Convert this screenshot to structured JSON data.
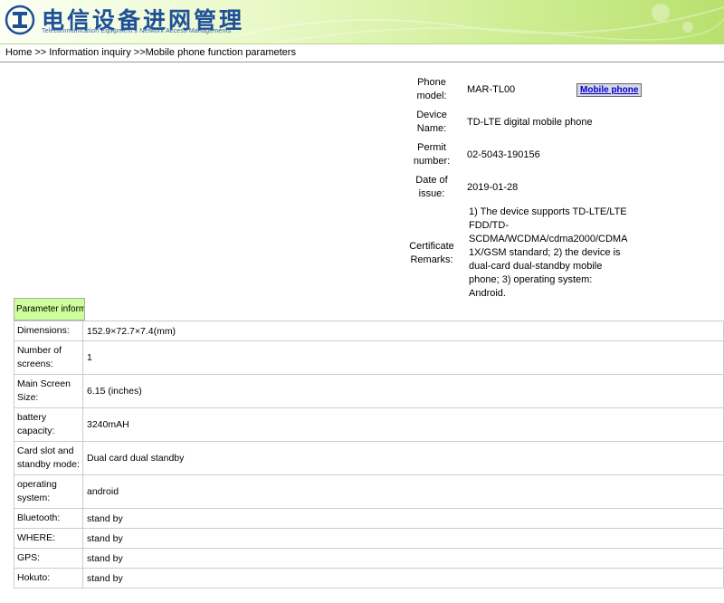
{
  "header": {
    "title_cn": "电信设备进网管理",
    "title_en": "Telecommunication Equipment's Network Access Managements"
  },
  "breadcrumb": {
    "home": "Home",
    "sep1": ">>",
    "info": "Information inquiry",
    "sep2": ">>",
    "current": "Mobile phone function parameters"
  },
  "device_info": {
    "button_label": "Mobile phone",
    "rows": [
      {
        "label": "Phone model:",
        "value": "MAR-TL00"
      },
      {
        "label": "Device Name:",
        "value": "TD-LTE digital mobile phone"
      },
      {
        "label": "Permit number:",
        "value": "02-5043-190156"
      },
      {
        "label": "Date of issue:",
        "value": "2019-01-28"
      },
      {
        "label": "Certificate Remarks:",
        "value": "1) The device supports TD-LTE/LTE FDD/TD-SCDMA/WCDMA/cdma2000/CDMA 1X/GSM standard; 2) the device is dual-card dual-standby mobile phone; 3) operating system: Android."
      }
    ]
  },
  "parameters": {
    "tab_label": "Parameter information",
    "rows": [
      {
        "label": "Dimensions:",
        "value": "152.9×72.7×7.4(mm)"
      },
      {
        "label": "Number of screens:",
        "value": "1"
      },
      {
        "label": "Main Screen Size:",
        "value": "6.15 (inches)"
      },
      {
        "label": "battery capacity:",
        "value": "3240mAH"
      },
      {
        "label": "Card slot and standby mode:",
        "value": "Dual card dual standby"
      },
      {
        "label": "operating system:",
        "value": "android"
      },
      {
        "label": "Bluetooth:",
        "value": "stand by"
      },
      {
        "label": "WHERE:",
        "value": "stand by"
      },
      {
        "label": "GPS:",
        "value": "stand by"
      },
      {
        "label": "Hokuto:",
        "value": "stand by"
      }
    ]
  }
}
